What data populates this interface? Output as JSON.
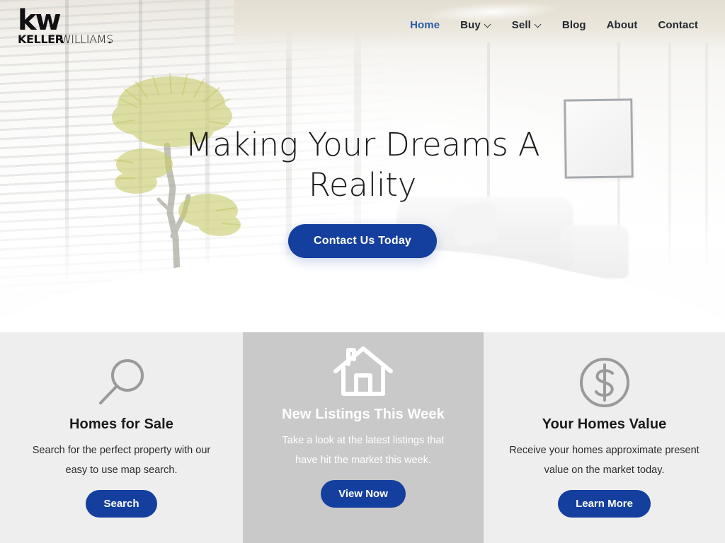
{
  "brand": {
    "monogram": "kw",
    "name_bold": "KELLER",
    "name_light": "WILLIAMS",
    "trademark": "."
  },
  "nav": {
    "items": [
      {
        "label": "Home",
        "active": true,
        "has_dropdown": false
      },
      {
        "label": "Buy",
        "active": false,
        "has_dropdown": true
      },
      {
        "label": "Sell",
        "active": false,
        "has_dropdown": true
      },
      {
        "label": "Blog",
        "active": false,
        "has_dropdown": false
      },
      {
        "label": "About",
        "active": false,
        "has_dropdown": false
      },
      {
        "label": "Contact",
        "active": false,
        "has_dropdown": false
      }
    ]
  },
  "hero": {
    "title": "Making Your Dreams A Reality",
    "cta_label": "Contact Us Today"
  },
  "features": [
    {
      "icon": "magnifier-icon",
      "title": "Homes for Sale",
      "description": "Search for the perfect property with our easy to use map search.",
      "button_label": "Search",
      "highlighted": false
    },
    {
      "icon": "house-icon",
      "title": "New Listings This Week",
      "description": "Take a look at the latest listings that have hit the market this week.",
      "button_label": "View Now",
      "highlighted": true
    },
    {
      "icon": "dollar-circle-icon",
      "title": "Your Homes Value",
      "description": "Receive your homes approximate present value on the market today.",
      "button_label": "Learn More",
      "highlighted": false
    }
  ],
  "colors": {
    "brand_blue": "#143f9e",
    "nav_active_blue": "#2a5caa",
    "nav_text": "#23292f",
    "column_bg": "#eeeeee",
    "column_highlight_bg": "#c9c9c9",
    "icon_gray": "#9a9a9a",
    "heading_dark": "#1a1a1a"
  }
}
